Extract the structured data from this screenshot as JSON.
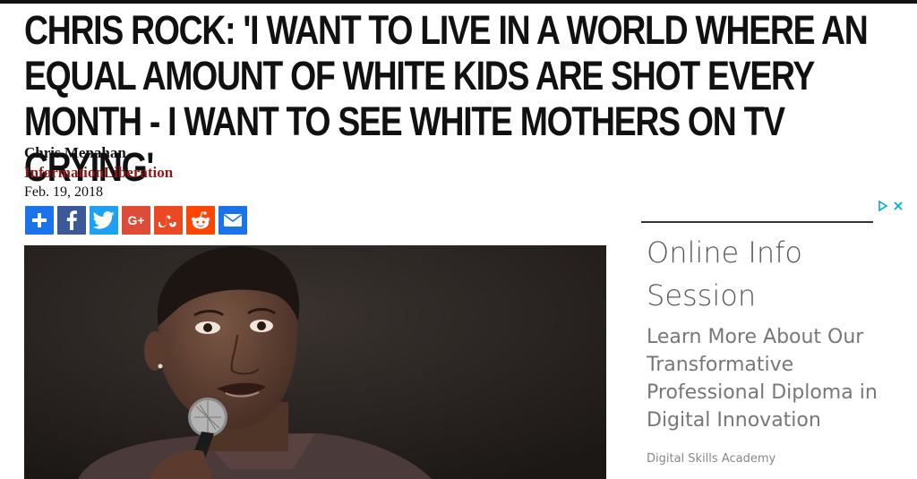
{
  "article": {
    "headline": "CHRIS ROCK: 'I WANT TO LIVE IN A WORLD WHERE AN EQUAL AMOUNT OF WHITE KIDS ARE SHOT EVERY MONTH - I WANT TO SEE WHITE MOTHERS ON TV CRYING'",
    "author": "Chris Menahan",
    "source": "InformationLiberation",
    "date": "Feb. 19, 2018"
  },
  "share": {
    "buttons": [
      {
        "name": "share-plus-button",
        "icon": "plus-icon",
        "color": "#1a73e8"
      },
      {
        "name": "share-facebook-button",
        "icon": "facebook-icon",
        "color": "#3b5998"
      },
      {
        "name": "share-twitter-button",
        "icon": "twitter-icon",
        "color": "#1da1f2"
      },
      {
        "name": "share-googleplus-button",
        "icon": "google-plus-icon",
        "color": "#dd4b39"
      },
      {
        "name": "share-stumbleupon-button",
        "icon": "stumbleupon-icon",
        "color": "#eb4924"
      },
      {
        "name": "share-reddit-button",
        "icon": "reddit-icon",
        "color": "#ff4500"
      },
      {
        "name": "share-email-button",
        "icon": "email-icon",
        "color": "#1a73e8"
      }
    ]
  },
  "ad": {
    "title": "Online Info Session",
    "body": "Learn More About Our Transformative Professional Diploma in Digital Innovation",
    "sponsor": "Digital Skills Academy",
    "choices_icons": [
      "adchoices-icon",
      "close-icon"
    ]
  },
  "colors": {
    "source_red": "#8b1a1a",
    "ad_text": "#777777"
  }
}
